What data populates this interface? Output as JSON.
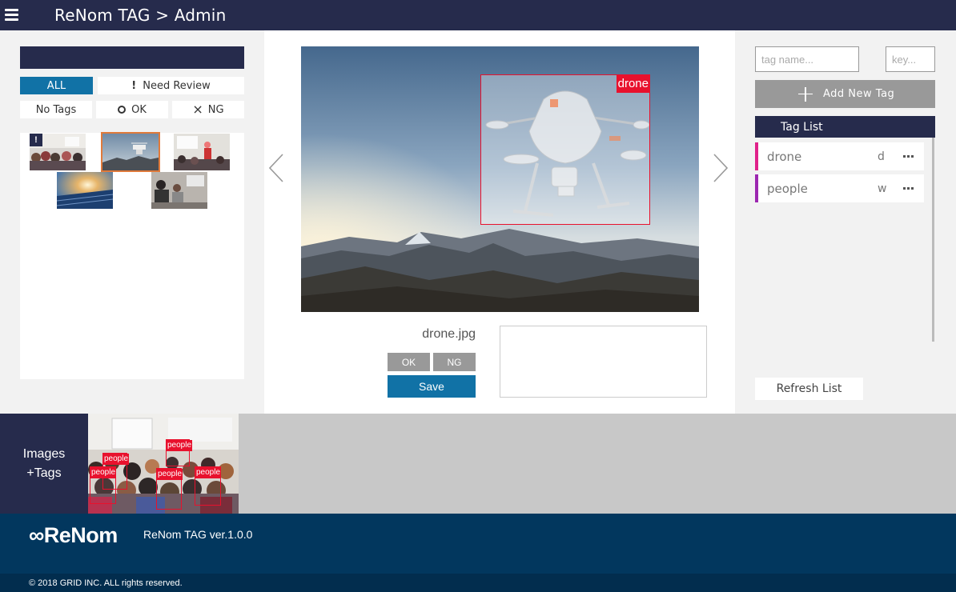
{
  "header": {
    "title": "ReNom TAG > Admin"
  },
  "filters": {
    "all": "ALL",
    "need_review": "Need Review",
    "no_tags": "No Tags",
    "ok": "OK",
    "ng": "NG",
    "need_review_icon": "!",
    "ok_icon": "○",
    "ng_icon": "×"
  },
  "thumbnails": {
    "badge": "!"
  },
  "main": {
    "bbox_label": "drone",
    "filename": "drone.jpg",
    "ok_label": "OK",
    "ng_label": "NG",
    "save_label": "Save"
  },
  "right": {
    "tag_name_placeholder": "tag name...",
    "key_placeholder": "key...",
    "add_tag_label": "Add New Tag",
    "tag_list_title": "Tag List",
    "tags": [
      {
        "name": "drone",
        "key": "d",
        "color": "#e0218a"
      },
      {
        "name": "people",
        "key": "w",
        "color": "#9c27b0"
      }
    ],
    "refresh_label": "Refresh List"
  },
  "bottom": {
    "label_line1": "Images",
    "label_line2": "+Tags",
    "preview_labels": [
      "people",
      "people",
      "people",
      "people",
      "people"
    ]
  },
  "footer": {
    "logo": "∞ReNom",
    "version": "ReNom TAG ver.1.0.0",
    "copyright": "© 2018 GRID INC. ALL rights reserved."
  },
  "colors": {
    "navy": "#262b4c",
    "accent_blue": "#1172a6",
    "bbox_red": "#e8112d",
    "footer_blue": "#02375e"
  }
}
